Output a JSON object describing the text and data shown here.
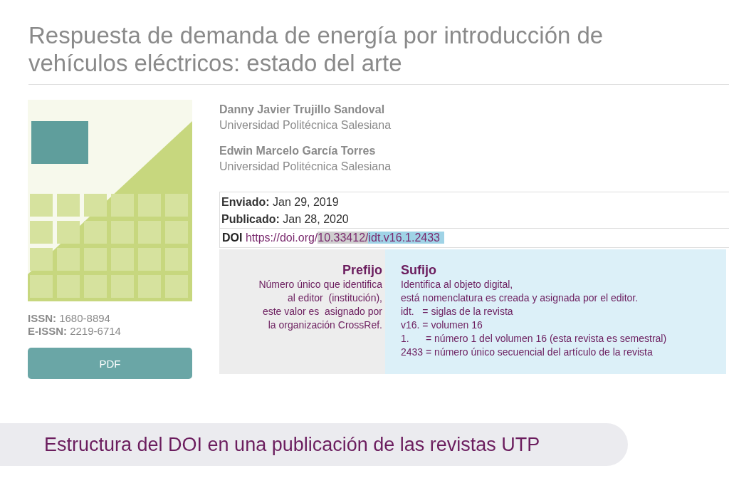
{
  "title": "Respuesta de demanda de energía por introducción de vehículos eléctricos: estado del arte",
  "issn": [
    {
      "label": "ISSN:",
      "value": "1680-8894"
    },
    {
      "label": "E-ISSN:",
      "value": "2219-6714"
    }
  ],
  "pdf_button": "PDF",
  "authors": [
    {
      "name": "Danny Javier Trujillo Sandoval",
      "affiliation": "Universidad Politécnica Salesiana"
    },
    {
      "name": "Edwin Marcelo García Torres",
      "affiliation": "Universidad Politécnica Salesiana"
    }
  ],
  "dates": [
    {
      "label": "Enviado:",
      "value": "Jan 29, 2019"
    },
    {
      "label": "Publicado:",
      "value": "Jan 28, 2020"
    }
  ],
  "doi": {
    "label": "DOI",
    "base": "https://doi.org/",
    "prefix": "10.33412/",
    "suffix": "idt.v16.1.2433"
  },
  "annotation": {
    "prefix": {
      "heading": "Prefijo",
      "lines": [
        "Número único que identifica",
        "al editor  (institución),",
        "este valor es  asignado por",
        "la organización CrossRef."
      ]
    },
    "suffix": {
      "heading": "Sufijo",
      "lines": [
        "Identifica al objeto digital,",
        "está nomenclatura es creada y asignada por el editor.",
        "idt.   = siglas de la revista",
        "v16. = volumen 16",
        "1.      = número 1 del volumen 16 (esta revista es semestral)",
        "2433 = número único secuencial del artículo de la revista"
      ]
    }
  },
  "caption": "Estructura del DOI en una publicación de las revistas UTP"
}
